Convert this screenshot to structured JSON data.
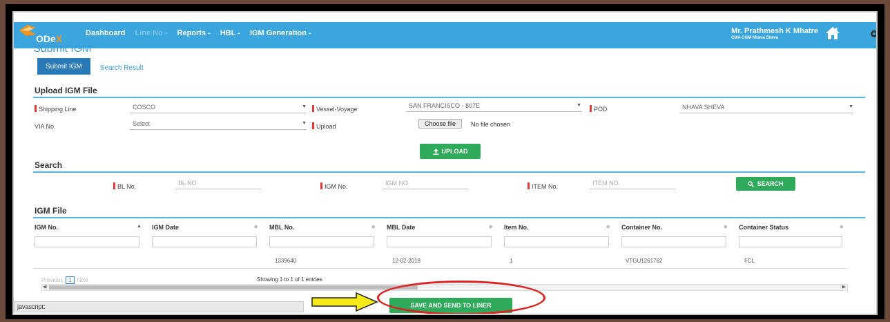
{
  "app": {
    "logo_prefix": "ODe",
    "logo_suffix": "X"
  },
  "nav": {
    "items": [
      {
        "label": "Dashboard",
        "muted": false
      },
      {
        "label": "Line No -",
        "muted": true
      },
      {
        "label": "Reports -",
        "muted": false
      },
      {
        "label": "HBL -",
        "muted": false
      },
      {
        "label": "IGM Generation -",
        "muted": false
      }
    ],
    "user_name": "Mr. Prathmesh K Mhatre",
    "user_org": "CMA CGM Nhava Sheva"
  },
  "page": {
    "title": "Submit IGM",
    "tabs": [
      "Submit IGM",
      "Search Result"
    ]
  },
  "upload_section": {
    "title": "Upload IGM File",
    "shipping_line_label": "Shipping Line",
    "shipping_line_value": "COSCO",
    "vessel_voyage_label": "Vessel-Voyage",
    "vessel_voyage_value": "SAN FRANCISCO - 807E",
    "pod_label": "POD",
    "pod_value": "NHAVA SHEVA",
    "via_label": "VIA No.",
    "via_value": "Select",
    "upload_label": "Upload",
    "choose_file_label": "Choose file",
    "file_status": "No file chosen",
    "upload_button": "UPLOAD"
  },
  "search_section": {
    "title": "Search",
    "bl_label": "BL No.",
    "bl_placeholder": "BL NO",
    "igm_label": "IGM No.",
    "igm_placeholder": "IGM NO",
    "item_label": "ITEM No.",
    "item_placeholder": "ITEM NO.",
    "search_button": "SEARCH"
  },
  "igm_file": {
    "title": "IGM File",
    "columns": [
      "IGM No.",
      "IGM Date",
      "MBL No.",
      "MBL Date",
      "Item No.",
      "Container No.",
      "Container Status"
    ],
    "rows": [
      [
        "",
        "",
        "1339640",
        "12-02-2018",
        "1",
        "VTGU1261762",
        "FCL"
      ]
    ],
    "pager_previous": "Previous",
    "pager_page": "1",
    "pager_next": "Next",
    "showing": "Showing 1 to 1 of 1 entries"
  },
  "footer": {
    "save_button": "SAVE AND SEND TO LINER",
    "status_text": "javascript:"
  },
  "colors": {
    "navbar": "#3aa6dd",
    "accent": "#2a7ab8",
    "green_button": "#2eaa5a",
    "required": "#e53935",
    "annotation_red": "#e02020",
    "annotation_arrow": "#f5ea1a"
  }
}
